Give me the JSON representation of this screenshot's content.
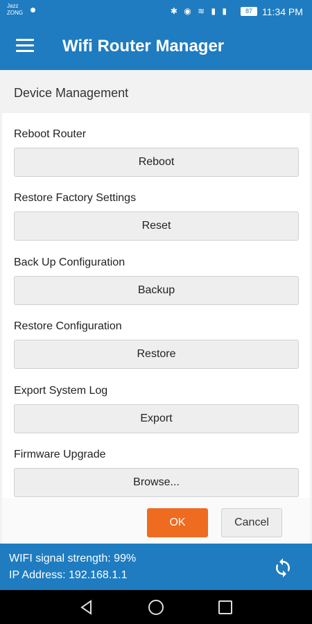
{
  "status_bar": {
    "carrier_line1": "Jazz",
    "carrier_line2": "ZONG",
    "icons": "✱ ◉ ≋ ▮ ▮",
    "battery": "87",
    "time": "11:34 PM"
  },
  "app_bar": {
    "menu_icon": "hamburger-menu-icon",
    "title": "Wifi Router Manager"
  },
  "section": {
    "title": "Device Management"
  },
  "rows": [
    {
      "label": "Reboot Router",
      "button": "Reboot"
    },
    {
      "label": "Restore Factory Settings",
      "button": "Reset"
    },
    {
      "label": "Back Up Configuration",
      "button": "Backup"
    },
    {
      "label": "Restore Configuration",
      "button": "Restore"
    },
    {
      "label": "Export System Log",
      "button": "Export"
    },
    {
      "label": "Firmware Upgrade",
      "button": "Browse..."
    }
  ],
  "dialog": {
    "ok_label": "OK",
    "cancel_label": "Cancel"
  },
  "info": {
    "signal_text": "WIFI signal strength: 99%",
    "ip_text": "IP Address: 192.168.1.1",
    "refresh_icon": "refresh-icon"
  },
  "colors": {
    "primary": "#1f7cc0",
    "accent": "#ee6b1f"
  }
}
